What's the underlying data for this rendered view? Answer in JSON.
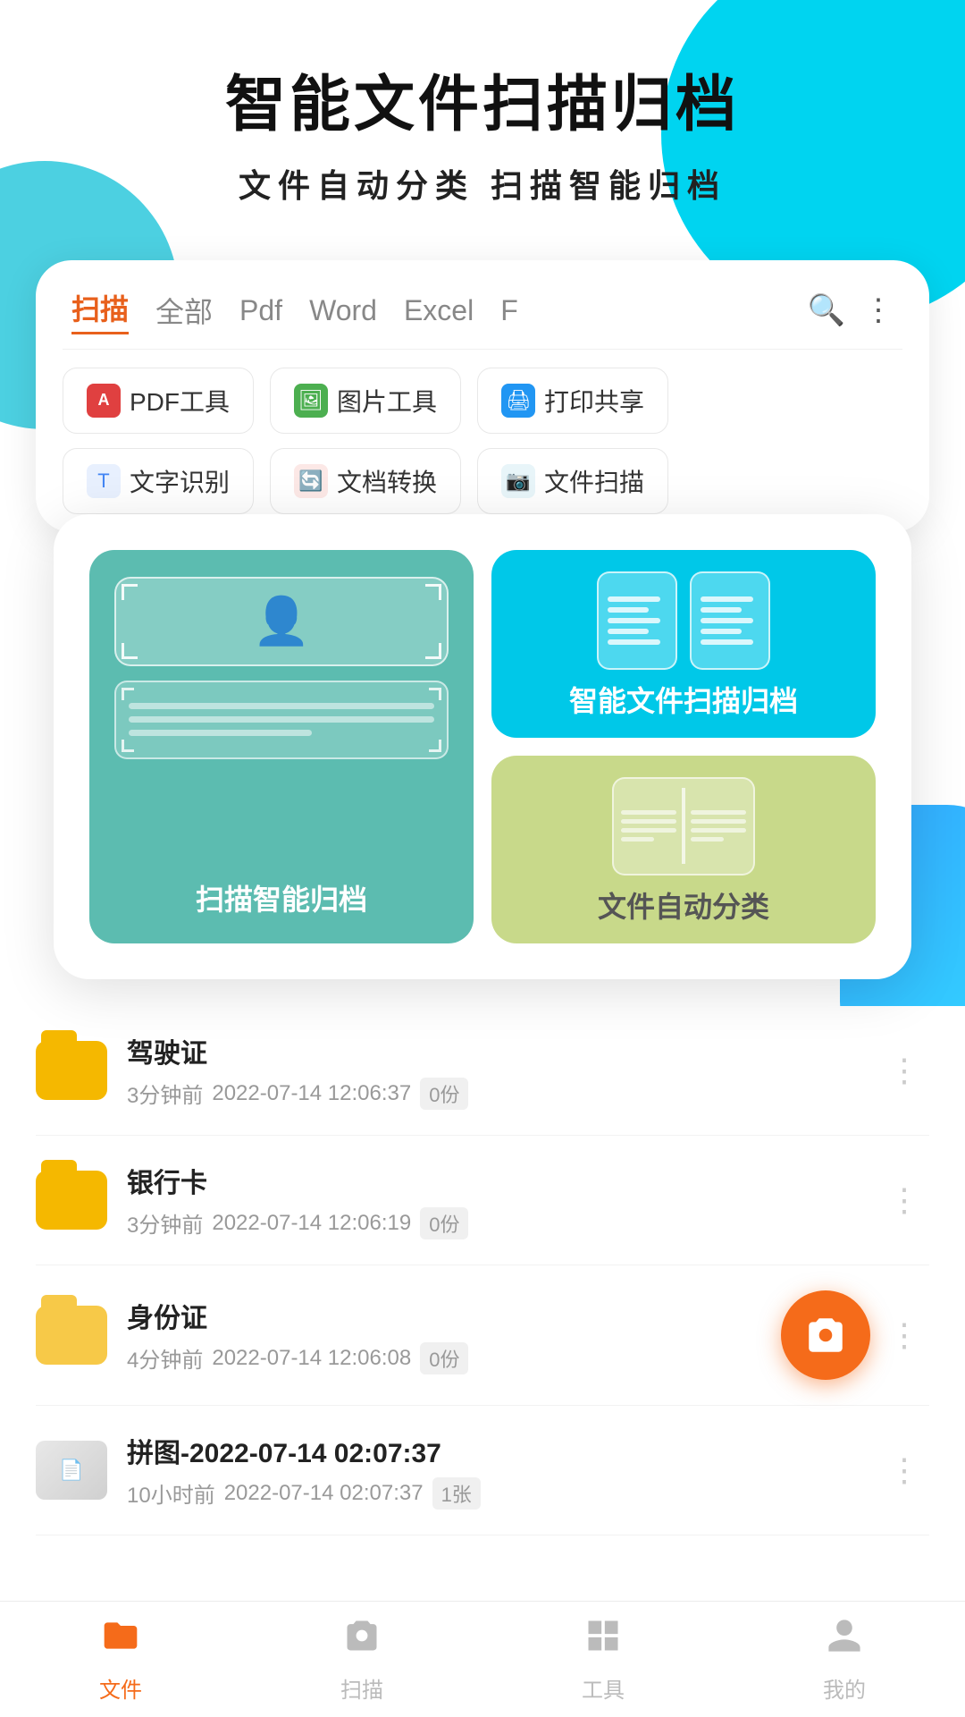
{
  "header": {
    "main_title": "智能文件扫描归档",
    "sub_title": "文件自动分类   扫描智能归档"
  },
  "tabs": {
    "items": [
      {
        "label": "扫描",
        "active": true
      },
      {
        "label": "全部",
        "active": false
      },
      {
        "label": "Pdf",
        "active": false
      },
      {
        "label": "Word",
        "active": false
      },
      {
        "label": "Excel",
        "active": false
      },
      {
        "label": "F",
        "active": false
      }
    ]
  },
  "tools_row1": [
    {
      "label": "PDF工具",
      "icon": "pdf"
    },
    {
      "label": "图片工具",
      "icon": "image"
    },
    {
      "label": "打印共享",
      "icon": "print"
    }
  ],
  "tools_row2": [
    {
      "label": "文字识别",
      "icon": "text-scan"
    },
    {
      "label": "文档转换",
      "icon": "doc-convert"
    },
    {
      "label": "文件扫描",
      "icon": "file-scan"
    }
  ],
  "feature_card": {
    "left_tile": {
      "label": "扫描智能归档"
    },
    "top_right_tile": {
      "label": "智能文件扫描归档"
    },
    "bottom_right_tile": {
      "label": "文件自动分类"
    }
  },
  "list_items": [
    {
      "name": "驾驶证",
      "time_ago": "3分钟前",
      "date": "2022-07-14 12:06:37",
      "count": "0份",
      "folder_type": "yellow"
    },
    {
      "name": "银行卡",
      "time_ago": "3分钟前",
      "date": "2022-07-14 12:06:19",
      "count": "0份",
      "folder_type": "yellow"
    },
    {
      "name": "身份证",
      "time_ago": "4分钟前",
      "date": "2022-07-14 12:06:08",
      "count": "0份",
      "folder_type": "light"
    },
    {
      "name": "拼图-2022-07-14 02:07:37",
      "time_ago": "10小时前",
      "date": "2022-07-14 02:07:37",
      "count": "1张",
      "folder_type": "thumb"
    }
  ],
  "bottom_nav": {
    "items": [
      {
        "label": "文件",
        "icon": "file",
        "active": true
      },
      {
        "label": "扫描",
        "icon": "camera",
        "active": false
      },
      {
        "label": "工具",
        "icon": "tools",
        "active": false
      },
      {
        "label": "我的",
        "icon": "user",
        "active": false
      }
    ]
  }
}
